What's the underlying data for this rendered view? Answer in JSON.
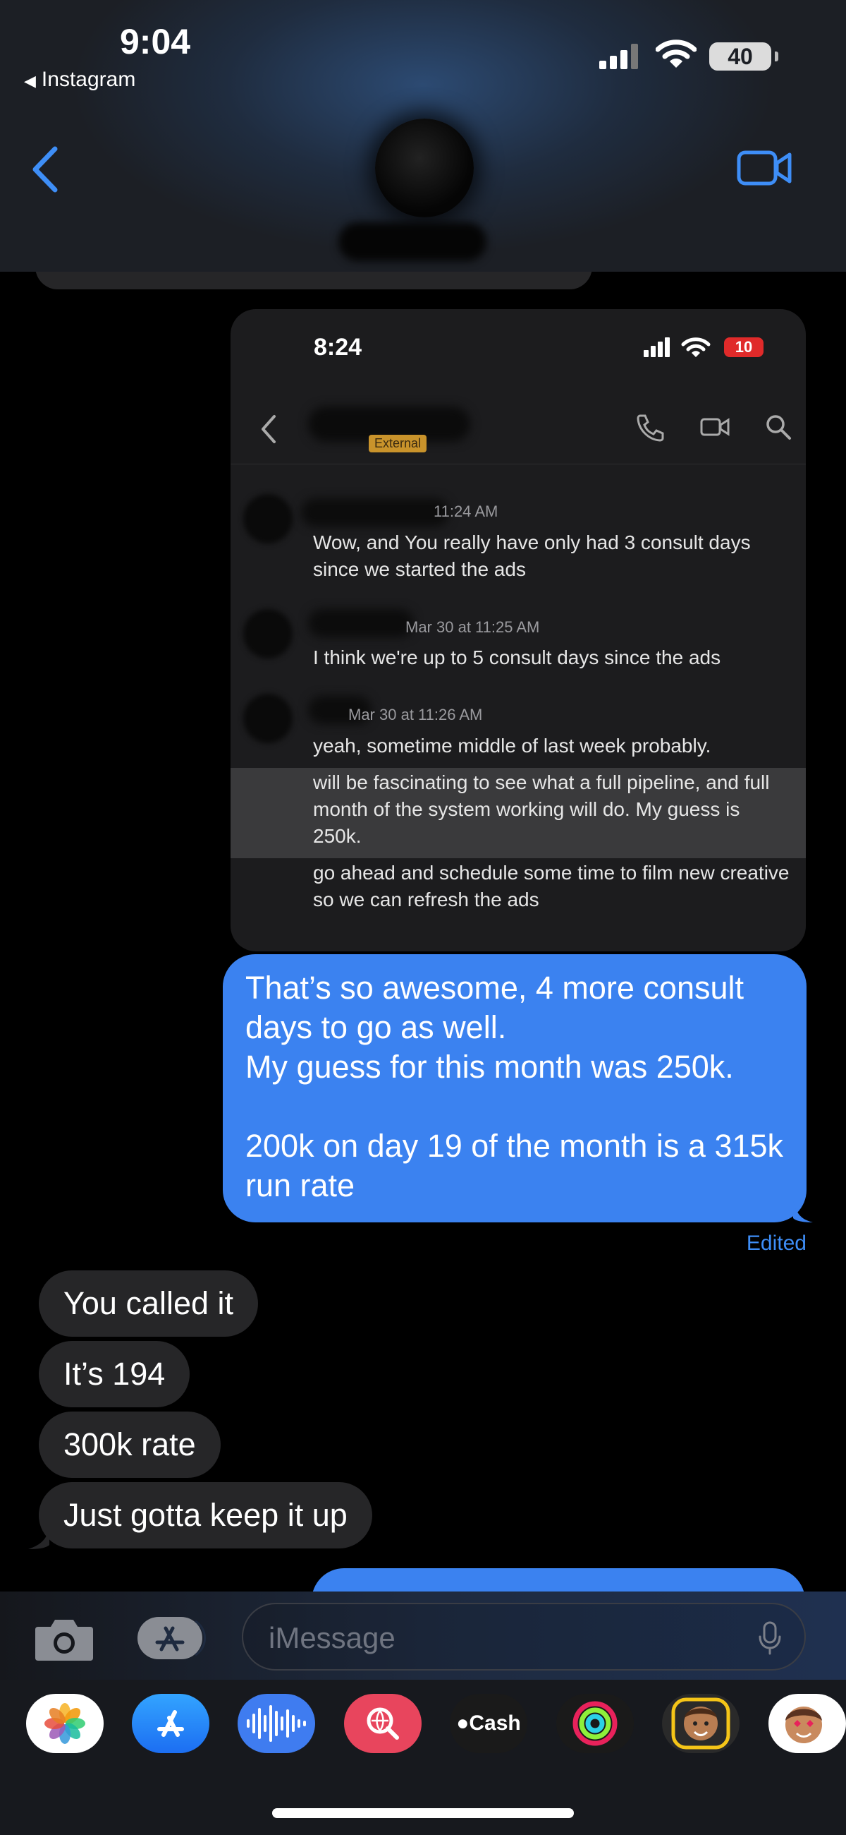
{
  "status_bar": {
    "time": "9:04",
    "back_app": "Instagram",
    "battery": "40"
  },
  "colors": {
    "blue_bubble": "#3b82f0",
    "gray_bubble": "#262628",
    "accent": "#3e8ef7"
  },
  "header": {
    "back_icon": "chevron-left-icon",
    "video_icon": "video-camera-icon"
  },
  "shared_screenshot": {
    "time": "8:24",
    "battery": "10",
    "tag": "External",
    "messages": [
      {
        "timestamp": "11:24 AM",
        "text": "Wow, and You really have only had 3 consult days since we started the ads"
      },
      {
        "timestamp": "Mar 30 at 11:25 AM",
        "text": "I think we're up to 5 consult days since the ads"
      },
      {
        "timestamp": "Mar 30 at 11:26 AM",
        "text": "yeah, sometime middle of last week probably."
      },
      {
        "text": "will be fascinating to see what a full pipeline, and full month of the system working will do. My guess is 250k."
      },
      {
        "text": "go ahead and schedule some time to film new creative so we can refresh the ads"
      }
    ]
  },
  "sent_message": {
    "text": "That’s so awesome, 4 more consult days to go as well.\nMy guess for this month was 250k.\n\n200k on day 19 of the month is a 315k run rate",
    "edited": "Edited"
  },
  "received_messages": [
    {
      "text": "You called it"
    },
    {
      "text": "It’s 194"
    },
    {
      "text": "300k rate"
    },
    {
      "text": "Just gotta keep it up"
    }
  ],
  "composer": {
    "placeholder": "iMessage"
  },
  "app_drawer": [
    {
      "name": "photos-app-icon"
    },
    {
      "name": "app-store-icon"
    },
    {
      "name": "audio-message-icon"
    },
    {
      "name": "image-search-icon"
    },
    {
      "name": "apple-cash-icon",
      "label": "Cash"
    },
    {
      "name": "fitness-icon"
    },
    {
      "name": "memoji-icon"
    },
    {
      "name": "memoji-stickers-icon"
    }
  ]
}
